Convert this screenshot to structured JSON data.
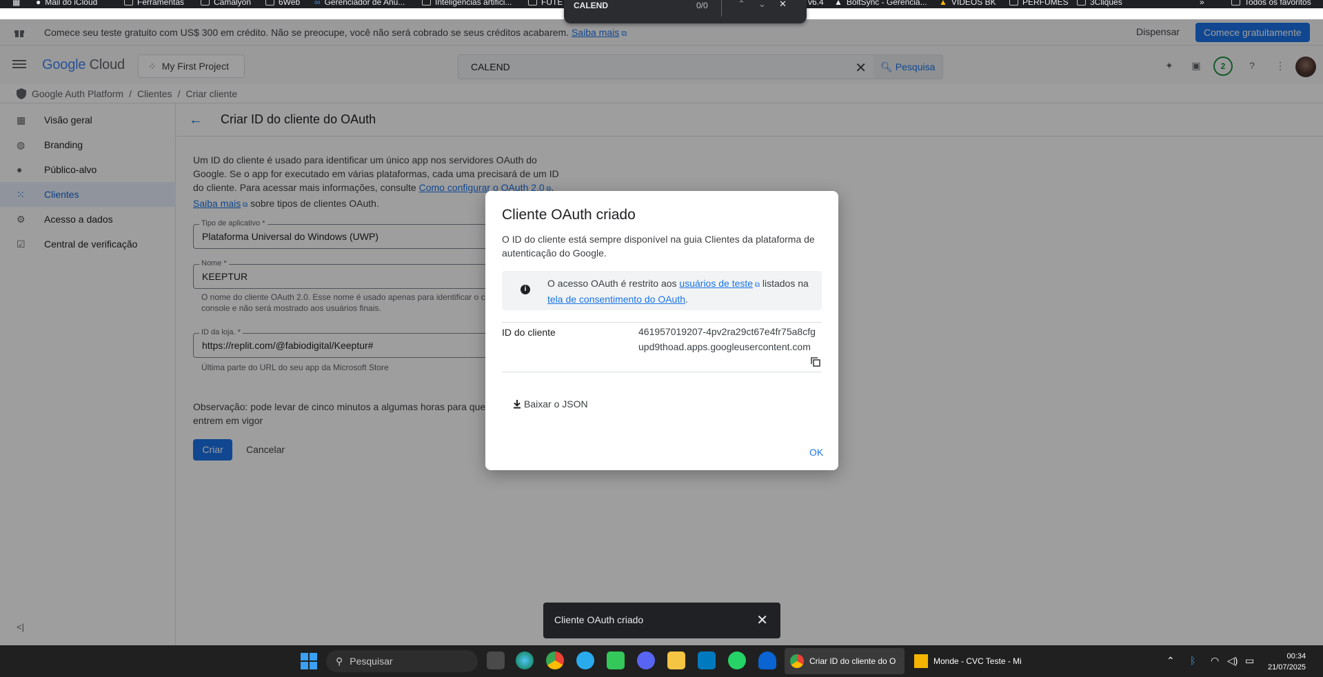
{
  "colors": {
    "accent": "#1a73e8",
    "active_nav_bg": "#e8f0fe",
    "snackbar_bg": "#202124",
    "taskbar_bg": "#202020"
  },
  "bookmarks": [
    "Mail do iCloud",
    "Ferramentas",
    "Camalyon",
    "6Web",
    "Gerenciador de Anú...",
    "Inteligencias artifici...",
    "FUTE",
    "v6.4",
    "BoltSync - Gerencia...",
    "VÍDEOS BK",
    "PERFUMES",
    "3Cliques",
    "»",
    "Todos os favoritos"
  ],
  "findbar": {
    "query": "CALEND",
    "count": "0/0"
  },
  "banner": {
    "message": "Comece seu teste gratuito com US$ 300 em crédito. Não se preocupe, você não será cobrado se seus créditos acabarem.",
    "link": "Saiba mais",
    "dismiss": "Dispensar",
    "cta": "Comece gratuitamente"
  },
  "header": {
    "logo_google": "Google",
    "logo_cloud": "Cloud",
    "project": "My First Project",
    "search_value": "CALEND",
    "search_button": "Pesquisa",
    "notification_count": "2"
  },
  "breadcrumb": [
    "Google Auth Platform",
    "Clientes",
    "Criar cliente"
  ],
  "sidebar": {
    "items": [
      {
        "label": "Visão geral",
        "icon": "dashboard-icon"
      },
      {
        "label": "Branding",
        "icon": "palette-icon"
      },
      {
        "label": "Público-alvo",
        "icon": "person-icon"
      },
      {
        "label": "Clientes",
        "icon": "grid-icon",
        "active": true
      },
      {
        "label": "Acesso a dados",
        "icon": "data-access-icon"
      },
      {
        "label": "Central de verificação",
        "icon": "verification-icon"
      }
    ]
  },
  "page": {
    "title": "Criar ID do cliente do OAuth",
    "intro_text": "Um ID do cliente é usado para identificar um único app nos servidores OAuth do Google. Se o app for executado em várias plataformas, cada uma precisará de um ID do cliente. Para acessar mais informações, consulte",
    "intro_link1": "Como configurar o OAuth 2.0",
    "intro_link2": "Saiba mais",
    "intro_tail": "sobre tipos de clientes OAuth.",
    "app_type_label": "Tipo de aplicativo *",
    "app_type_value": "Plataforma Universal do Windows (UWP)",
    "name_label": "Nome *",
    "name_value": "KEEPTUR",
    "name_hint": "O nome do cliente OAuth 2.0. Esse nome é usado apenas para identificar o cli console e não será mostrado aos usuários finais.",
    "store_label": "ID da loja. *",
    "store_value": "https://replit.com/@fabiodigital/Keeptur#",
    "store_hint": "Última parte do URL do seu app da Microsoft Store",
    "note": "Observação: pode levar de cinco minutos a algumas horas para que configurações entrem em vigor",
    "create": "Criar",
    "cancel": "Cancelar"
  },
  "dialog": {
    "title": "Cliente OAuth criado",
    "description": "O ID do cliente está sempre disponível na guia Clientes da plataforma de autenticação do Google.",
    "note_prefix": "O acesso OAuth é restrito aos",
    "note_link1": "usuários de teste",
    "note_middle": "listados na",
    "note_link2": "tela de consentimento do OAuth",
    "note_suffix": ".",
    "client_id_label": "ID do cliente",
    "client_id_value": "461957019207-4pv2ra29ct67e4fr75a8cfgupd9thoad.apps.googleusercontent.com",
    "download": "Baixar o JSON",
    "ok": "OK"
  },
  "snackbar": {
    "text": "Cliente OAuth criado"
  },
  "taskbar": {
    "search_placeholder": "Pesquisar",
    "window1": "Criar ID do cliente do O",
    "window2": "Monde - CVC Teste - Mi",
    "time": "00:34",
    "date": "21/07/2025"
  }
}
